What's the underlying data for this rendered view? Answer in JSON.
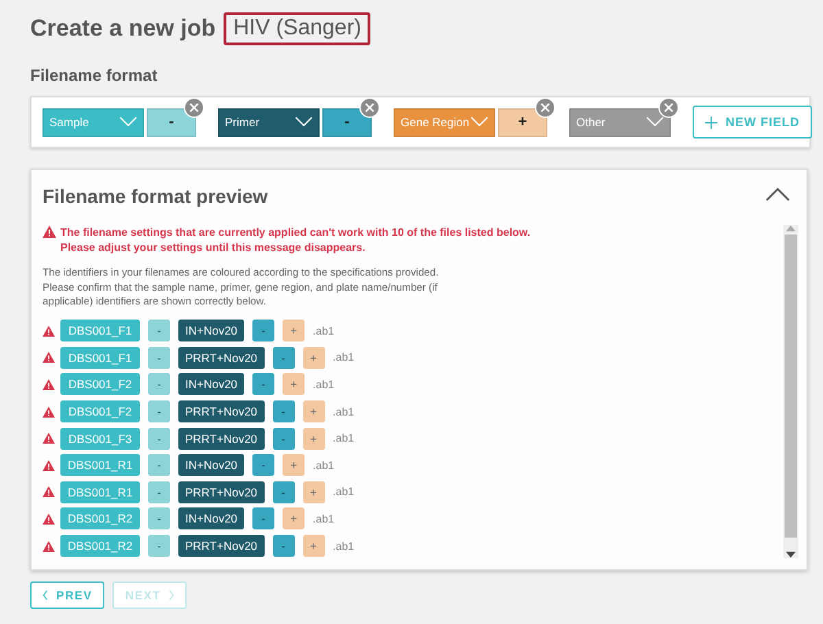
{
  "title": "Create a new job",
  "job_type": "HIV (Sanger)",
  "filename_format": {
    "heading": "Filename format",
    "fields": [
      {
        "label": "Sample",
        "kind": "sample",
        "separator": "-"
      },
      {
        "label": "Primer",
        "kind": "primer",
        "separator": "-"
      },
      {
        "label": "Gene Region",
        "kind": "gene",
        "separator": "+"
      },
      {
        "label": "Other",
        "kind": "other"
      }
    ],
    "new_field_button": "NEW FIELD"
  },
  "preview": {
    "heading": "Filename format preview",
    "expanded": true,
    "error": "The filename settings that are currently applied can't work with 10 of the files listed below.\nPlease adjust your settings until this message disappears.",
    "info": "The identifiers in your filenames are coloured according to the specifications provided.\nPlease confirm that the sample name, primer, gene region, and plate name/number (if applicable) identifiers are shown correctly below.",
    "rows": [
      {
        "warning": true,
        "segments": [
          {
            "kind": "sample",
            "text": "DBS001_F1"
          },
          {
            "kind": "sep1",
            "text": "-"
          },
          {
            "kind": "primer",
            "text": "IN+Nov20"
          },
          {
            "kind": "sep2",
            "text": "-"
          },
          {
            "kind": "gene",
            "text": "+"
          },
          {
            "kind": "plain",
            "text": ".ab1"
          }
        ]
      },
      {
        "warning": true,
        "segments": [
          {
            "kind": "sample",
            "text": "DBS001_F1"
          },
          {
            "kind": "sep1",
            "text": "-"
          },
          {
            "kind": "primer",
            "text": "PRRT+Nov20"
          },
          {
            "kind": "sep2",
            "text": "-"
          },
          {
            "kind": "gene",
            "text": "+"
          },
          {
            "kind": "plain",
            "text": ".ab1"
          }
        ]
      },
      {
        "warning": true,
        "segments": [
          {
            "kind": "sample",
            "text": "DBS001_F2"
          },
          {
            "kind": "sep1",
            "text": "-"
          },
          {
            "kind": "primer",
            "text": "IN+Nov20"
          },
          {
            "kind": "sep2",
            "text": "-"
          },
          {
            "kind": "gene",
            "text": "+"
          },
          {
            "kind": "plain",
            "text": ".ab1"
          }
        ]
      },
      {
        "warning": true,
        "segments": [
          {
            "kind": "sample",
            "text": "DBS001_F2"
          },
          {
            "kind": "sep1",
            "text": "-"
          },
          {
            "kind": "primer",
            "text": "PRRT+Nov20"
          },
          {
            "kind": "sep2",
            "text": "-"
          },
          {
            "kind": "gene",
            "text": "+"
          },
          {
            "kind": "plain",
            "text": ".ab1"
          }
        ]
      },
      {
        "warning": true,
        "segments": [
          {
            "kind": "sample",
            "text": "DBS001_F3"
          },
          {
            "kind": "sep1",
            "text": "-"
          },
          {
            "kind": "primer",
            "text": "PRRT+Nov20"
          },
          {
            "kind": "sep2",
            "text": "-"
          },
          {
            "kind": "gene",
            "text": "+"
          },
          {
            "kind": "plain",
            "text": ".ab1"
          }
        ]
      },
      {
        "warning": true,
        "segments": [
          {
            "kind": "sample",
            "text": "DBS001_R1"
          },
          {
            "kind": "sep1",
            "text": "-"
          },
          {
            "kind": "primer",
            "text": "IN+Nov20"
          },
          {
            "kind": "sep2",
            "text": "-"
          },
          {
            "kind": "gene",
            "text": "+"
          },
          {
            "kind": "plain",
            "text": ".ab1"
          }
        ]
      },
      {
        "warning": true,
        "segments": [
          {
            "kind": "sample",
            "text": "DBS001_R1"
          },
          {
            "kind": "sep1",
            "text": "-"
          },
          {
            "kind": "primer",
            "text": "PRRT+Nov20"
          },
          {
            "kind": "sep2",
            "text": "-"
          },
          {
            "kind": "gene",
            "text": "+"
          },
          {
            "kind": "plain",
            "text": ".ab1"
          }
        ]
      },
      {
        "warning": true,
        "segments": [
          {
            "kind": "sample",
            "text": "DBS001_R2"
          },
          {
            "kind": "sep1",
            "text": "-"
          },
          {
            "kind": "primer",
            "text": "IN+Nov20"
          },
          {
            "kind": "sep2",
            "text": "-"
          },
          {
            "kind": "gene",
            "text": "+"
          },
          {
            "kind": "plain",
            "text": ".ab1"
          }
        ]
      },
      {
        "warning": true,
        "segments": [
          {
            "kind": "sample",
            "text": "DBS001_R2"
          },
          {
            "kind": "sep1",
            "text": "-"
          },
          {
            "kind": "primer",
            "text": "PRRT+Nov20"
          },
          {
            "kind": "sep2",
            "text": "-"
          },
          {
            "kind": "gene",
            "text": "+"
          },
          {
            "kind": "plain",
            "text": ".ab1"
          }
        ]
      }
    ]
  },
  "buttons": [
    {
      "label": "PREV",
      "kind": "prev",
      "disabled": false
    },
    {
      "label": "NEXT",
      "kind": "next",
      "disabled": true
    }
  ]
}
